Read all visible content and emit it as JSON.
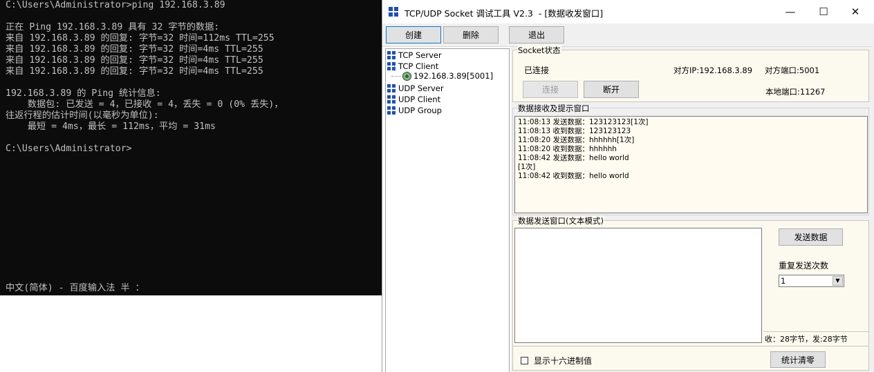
{
  "console": {
    "lines": [
      "C:\\Users\\Administrator>ping 192.168.3.89",
      "",
      "正在 Ping 192.168.3.89 具有 32 字节的数据:",
      "来自 192.168.3.89 的回复: 字节=32 时间=112ms TTL=255",
      "来自 192.168.3.89 的回复: 字节=32 时间=4ms TTL=255",
      "来自 192.168.3.89 的回复: 字节=32 时间=4ms TTL=255",
      "来自 192.168.3.89 的回复: 字节=32 时间=4ms TTL=255",
      "",
      "192.168.3.89 的 Ping 统计信息:",
      "    数据包: 已发送 = 4，已接收 = 4，丢失 = 0 (0% 丢失)，",
      "往返行程的估计时间(以毫秒为单位):",
      "    最短 = 4ms，最长 = 112ms，平均 = 31ms",
      "",
      "C:\\Users\\Administrator>"
    ],
    "ime_status": "中文(简体) - 百度输入法 半 ："
  },
  "tool": {
    "title": "TCP/UDP Socket 调试工具 V2.3  - [数据收发窗口]",
    "window_buttons": {
      "minimize": "—",
      "maximize": "☐",
      "close": "✕"
    },
    "toolbar": {
      "create": "创建",
      "delete": "删除",
      "exit": "退出"
    },
    "tree": {
      "items": [
        "TCP Server",
        "TCP Client",
        "UDP Server",
        "UDP Client",
        "UDP Group"
      ],
      "child": "192.168.3.89[5001]"
    },
    "socket_state": {
      "legend": "Socket状态",
      "status": "已连接",
      "peer_ip": "对方IP:192.168.3.89",
      "peer_port": "对方端口:5001",
      "local_port": "本地端口:11267",
      "connect": "连接",
      "disconnect": "断开"
    },
    "recv": {
      "legend": "数据接收及提示窗口",
      "log": [
        "11:08:13 发送数据：123123123[1次]",
        "11:08:13 收到数据：123123123",
        "11:08:20 发送数据：hhhhhh[1次]",
        "11:08:20 收到数据：hhhhhh",
        "11:08:42 发送数据：hello world",
        "[1次]",
        "11:08:42 收到数据：hello world"
      ]
    },
    "send": {
      "legend": "数据发送窗口(文本模式)",
      "send_button": "发送数据",
      "repeat_label": "重复发送次数",
      "repeat_value": "1",
      "stats": "收：28字节，发:28字节",
      "hex_label": "显示十六进制值",
      "reset_button": "统计清零"
    }
  }
}
